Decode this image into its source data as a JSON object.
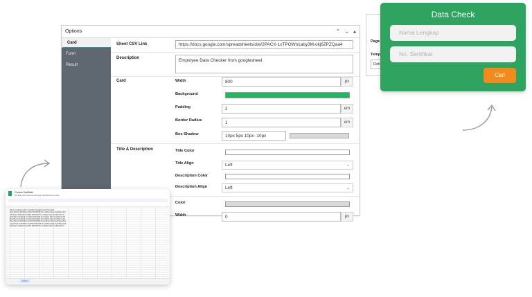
{
  "panel": {
    "title": "Options",
    "ctrl_up": "⌃",
    "ctrl_down": "⌄",
    "ctrl_toggle": "▴",
    "tabs": [
      "Card",
      "Form",
      "Result"
    ]
  },
  "fields": {
    "sheet_csv_label": "Sheet CSV Link",
    "sheet_csv_value": "https://docs.google.com/spreadsheets/d/e/2PACX-1vTPOWn1aby3M-okj6ZPZQaa4",
    "description_label": "Description",
    "description_value": "Employee Data Checker from googlesheet",
    "card_label": "Card",
    "width_label": "Width",
    "width_value": "800",
    "width_unit": "px",
    "background_label": "Background",
    "background_color": "#1fb75f",
    "padding_label": "Padding",
    "padding_value": "2",
    "padding_unit": "em",
    "radius_label": "Border Radius",
    "radius_value": "1",
    "radius_unit": "em",
    "shadow_label": "Box Shadow",
    "shadow_value": "10px 5px 10px -10px",
    "title_desc_label": "Title & Description",
    "title_color_label": "Title Color",
    "title_align_label": "Title Align",
    "title_align_value": "Left",
    "desc_color_label": "Description Color",
    "desc_align_label": "Description Align",
    "desc_align_value": "Left",
    "color_label": "Color",
    "width2_label": "Width",
    "width2_value": "0",
    "width2_unit": "px"
  },
  "right_panel": {
    "label1": "Page A",
    "label2": "Templ",
    "select_value": "Defa"
  },
  "card": {
    "title": "Data Check",
    "name_placeholder": "Nama Lengkap",
    "cert_placeholder": "No. Sertifikat",
    "button_label": "Cari",
    "accent": "#2fa460",
    "button_color": "#f28b1b"
  },
  "sheet": {
    "name": "Contoh Sertifikat",
    "menu": "File  Edit  View  Insert  Format  Data  Tools  Extensions  Help",
    "tab": "Sheet1",
    "rows": [
      "Nama Lengkap   Kota   No. Sertifikat   Tanggal   Status   Download",
      "Agus    Bantul   1100101  Cert1001   6/04/2023   Terverifikasi  https://sertifikat.link/1",
      "Adi     Bantul   1100102  Cert1002   6/04/2023   Terverifikasi  https://sertifikat.link/2",
      "Dedi    Bantul   1100103  Cert1003   6/04/2023   Terverifikasi  https://sertifikat.link/3",
      "Budi    Bantul   1100104  Cert1004   6/04/2023   Terverifikasi  https://sertifikat.link/4",
      "Rinto   Bantul   1100105  Cert1005   6/04/2023   Terverifikasi  https://sertifikat.link/5",
      "Yanto   Bantul   1100106  Cert1006   6/04/2023   Terverifikasi  https://sertifikat.link/6",
      "Dik     Bantul   1100107  Cert1007   6/04/2023   Terverifikasi  https://sertifikat.link/7"
    ]
  }
}
